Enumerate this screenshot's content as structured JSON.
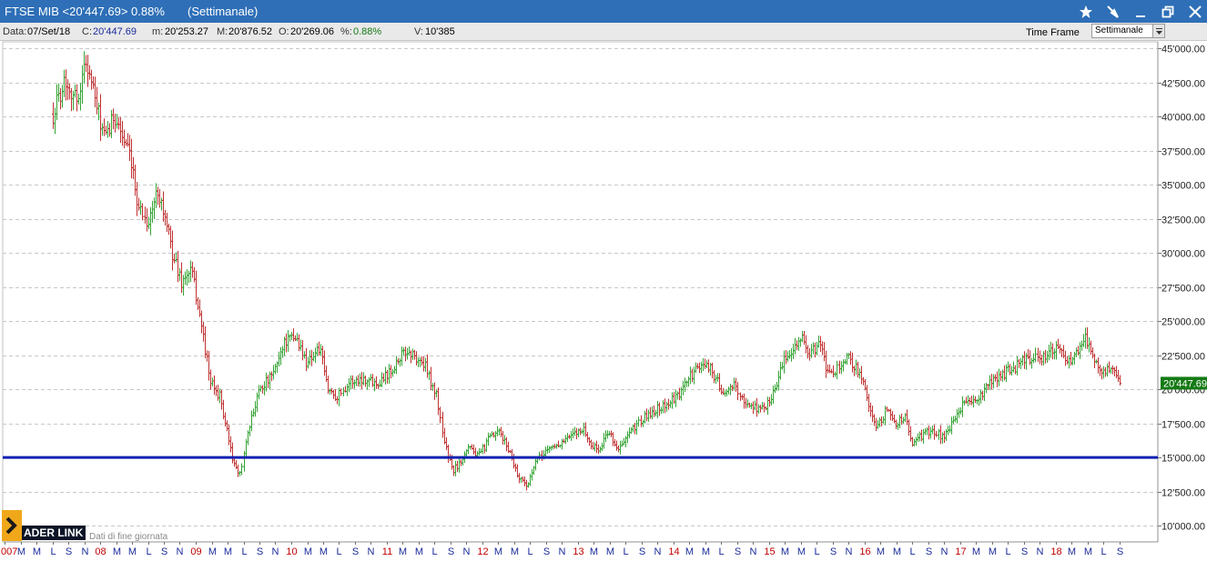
{
  "window": {
    "title": "FTSE MIB <20'447.69> 0.88%",
    "subtitle": "(Settimanale)",
    "buttons": [
      "star-icon",
      "pin-icon",
      "minimize-icon",
      "restore-icon",
      "close-icon"
    ]
  },
  "infobar": {
    "data_label": "Data:",
    "data_value": "07/Set/18",
    "close_label": "C:",
    "close_value": "20'447.69",
    "min_label": "m:",
    "min_value": "20'253.27",
    "max_label": "M:",
    "max_value": "20'876.52",
    "open_label": "O:",
    "open_value": "20'269.06",
    "pct_label": "%:",
    "pct_value": "0.88%",
    "vol_label": "V:",
    "vol_value": "10'385",
    "timeframe_label": "Time Frame",
    "timeframe_value": "Settimanale"
  },
  "logo": {
    "text": "ADER LINK",
    "subtext": "Dati di fine giornata"
  },
  "colors": {
    "up": "#33a333",
    "down": "#c03030",
    "support": "#1020b0",
    "grid": "#c8c8c8",
    "last_price_bg": "#157a15",
    "year_label": "#c00000",
    "month_label": "#1a2a9a"
  },
  "chart_data": {
    "type": "ohlc",
    "frequency": "weekly",
    "x_range": [
      2007.5,
      2018.94
    ],
    "ylim": [
      8800,
      45500
    ],
    "y_ticks": [
      10000,
      12500,
      15000,
      17500,
      20000,
      22500,
      25000,
      27500,
      30000,
      32500,
      35000,
      37500,
      40000,
      42500,
      45000
    ],
    "y_tick_labels": [
      "10'000.00",
      "12'500.00",
      "15'000.00",
      "17'500.00",
      "20'000.00",
      "22'500.00",
      "25'000.00",
      "27'500.00",
      "30'000.00",
      "32'500.00",
      "35'000.00",
      "37'500.00",
      "40'000.00",
      "42'500.00",
      "45'000.00"
    ],
    "last_price": 20447.69,
    "last_price_label": "20'447.69",
    "support_line": 15000,
    "grid": true,
    "x_labels": [
      "007",
      "M",
      "M",
      "L",
      "S",
      "N",
      "08",
      "M",
      "M",
      "L",
      "S",
      "N",
      "09",
      "M",
      "M",
      "L",
      "S",
      "N",
      "10",
      "M",
      "M",
      "L",
      "S",
      "N",
      "11",
      "M",
      "M",
      "L",
      "S",
      "N",
      "12",
      "M",
      "M",
      "L",
      "S",
      "N",
      "13",
      "M",
      "M",
      "L",
      "S",
      "N",
      "14",
      "M",
      "M",
      "L",
      "S",
      "N",
      "15",
      "M",
      "M",
      "L",
      "S",
      "N",
      "16",
      "M",
      "M",
      "L",
      "S",
      "N",
      "17",
      "M",
      "M",
      "L",
      "S",
      "N",
      "18",
      "M",
      "M",
      "L",
      "S"
    ],
    "x_label_positions": [
      2007.0,
      2007.167,
      2007.333,
      2007.5,
      2007.667,
      2007.833,
      2008.0,
      2008.167,
      2008.333,
      2008.5,
      2008.667,
      2008.833,
      2009.0,
      2009.167,
      2009.333,
      2009.5,
      2009.667,
      2009.833,
      2010.0,
      2010.167,
      2010.333,
      2010.5,
      2010.667,
      2010.833,
      2011.0,
      2011.167,
      2011.333,
      2011.5,
      2011.667,
      2011.833,
      2012.0,
      2012.167,
      2012.333,
      2012.5,
      2012.667,
      2012.833,
      2013.0,
      2013.167,
      2013.333,
      2013.5,
      2013.667,
      2013.833,
      2014.0,
      2014.167,
      2014.333,
      2014.5,
      2014.667,
      2014.833,
      2015.0,
      2015.167,
      2015.333,
      2015.5,
      2015.667,
      2015.833,
      2016.0,
      2016.167,
      2016.333,
      2016.5,
      2016.667,
      2016.833,
      2017.0,
      2017.167,
      2017.333,
      2017.5,
      2017.667,
      2017.833,
      2018.0,
      2018.167,
      2018.333,
      2018.5,
      2018.667
    ],
    "anchors": [
      [
        2007.5,
        40200
      ],
      [
        2007.62,
        42800
      ],
      [
        2007.75,
        41200
      ],
      [
        2007.85,
        44200
      ],
      [
        2007.95,
        41000
      ],
      [
        2008.05,
        38200
      ],
      [
        2008.15,
        40200
      ],
      [
        2008.3,
        37200
      ],
      [
        2008.4,
        33500
      ],
      [
        2008.5,
        32200
      ],
      [
        2008.6,
        34800
      ],
      [
        2008.75,
        30000
      ],
      [
        2008.85,
        27800
      ],
      [
        2008.95,
        28800
      ],
      [
        2009.05,
        25000
      ],
      [
        2009.15,
        20500
      ],
      [
        2009.25,
        19500
      ],
      [
        2009.38,
        15000
      ],
      [
        2009.45,
        13500
      ],
      [
        2009.55,
        17000
      ],
      [
        2009.65,
        20000
      ],
      [
        2009.8,
        21000
      ],
      [
        2009.92,
        23500
      ],
      [
        2010.05,
        23800
      ],
      [
        2010.15,
        22000
      ],
      [
        2010.3,
        23000
      ],
      [
        2010.38,
        20000
      ],
      [
        2010.48,
        19500
      ],
      [
        2010.6,
        20500
      ],
      [
        2010.75,
        20800
      ],
      [
        2010.9,
        20500
      ],
      [
        2011.05,
        21500
      ],
      [
        2011.15,
        22500
      ],
      [
        2011.22,
        22800
      ],
      [
        2011.4,
        21700
      ],
      [
        2011.52,
        19500
      ],
      [
        2011.6,
        16000
      ],
      [
        2011.68,
        14000
      ],
      [
        2011.75,
        14500
      ],
      [
        2011.85,
        16000
      ],
      [
        2011.95,
        15000
      ],
      [
        2012.08,
        16500
      ],
      [
        2012.18,
        16800
      ],
      [
        2012.28,
        15500
      ],
      [
        2012.38,
        13500
      ],
      [
        2012.48,
        13000
      ],
      [
        2012.55,
        14500
      ],
      [
        2012.65,
        15500
      ],
      [
        2012.8,
        16000
      ],
      [
        2012.92,
        16500
      ],
      [
        2013.05,
        17200
      ],
      [
        2013.12,
        16000
      ],
      [
        2013.22,
        15500
      ],
      [
        2013.32,
        17000
      ],
      [
        2013.42,
        15500
      ],
      [
        2013.52,
        16500
      ],
      [
        2013.62,
        17500
      ],
      [
        2013.8,
        18500
      ],
      [
        2013.95,
        19000
      ],
      [
        2014.05,
        19500
      ],
      [
        2014.15,
        20800
      ],
      [
        2014.25,
        21500
      ],
      [
        2014.35,
        22000
      ],
      [
        2014.42,
        21000
      ],
      [
        2014.55,
        19500
      ],
      [
        2014.65,
        20500
      ],
      [
        2014.72,
        19000
      ],
      [
        2014.85,
        18700
      ],
      [
        2014.95,
        18500
      ],
      [
        2015.05,
        20000
      ],
      [
        2015.15,
        22000
      ],
      [
        2015.25,
        23200
      ],
      [
        2015.35,
        23700
      ],
      [
        2015.42,
        22500
      ],
      [
        2015.55,
        23500
      ],
      [
        2015.6,
        21000
      ],
      [
        2015.7,
        21500
      ],
      [
        2015.82,
        22300
      ],
      [
        2015.92,
        21500
      ],
      [
        2016.02,
        19500
      ],
      [
        2016.12,
        17000
      ],
      [
        2016.22,
        18500
      ],
      [
        2016.32,
        17500
      ],
      [
        2016.42,
        18000
      ],
      [
        2016.5,
        16000
      ],
      [
        2016.58,
        16500
      ],
      [
        2016.7,
        17000
      ],
      [
        2016.82,
        16500
      ],
      [
        2016.92,
        17500
      ],
      [
        2017.02,
        19000
      ],
      [
        2017.12,
        19000
      ],
      [
        2017.22,
        19500
      ],
      [
        2017.32,
        20500
      ],
      [
        2017.42,
        21000
      ],
      [
        2017.55,
        21500
      ],
      [
        2017.65,
        22000
      ],
      [
        2017.78,
        22500
      ],
      [
        2017.9,
        22200
      ],
      [
        2018.0,
        23300
      ],
      [
        2018.1,
        22000
      ],
      [
        2018.2,
        22500
      ],
      [
        2018.3,
        24000
      ],
      [
        2018.38,
        22500
      ],
      [
        2018.48,
        21500
      ],
      [
        2018.58,
        21300
      ],
      [
        2018.65,
        20800
      ],
      [
        2018.68,
        20447.69
      ]
    ]
  }
}
